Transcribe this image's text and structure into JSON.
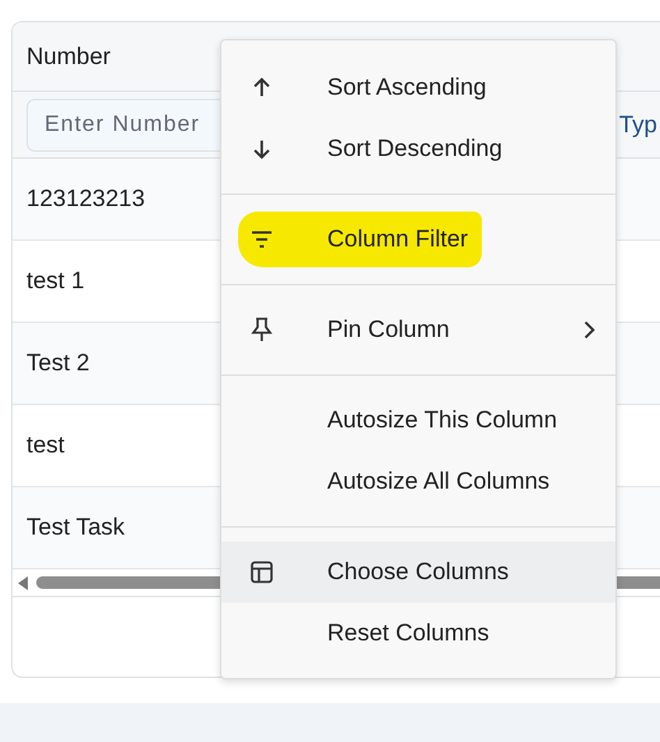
{
  "grid": {
    "column": "Number",
    "filter": {
      "placeholder": "Enter Number"
    },
    "next_filter_text": "Typ",
    "rows": [
      "123123213",
      "test 1",
      "Test 2",
      "test",
      "Test Task"
    ]
  },
  "menu": {
    "groups": [
      [
        {
          "label": "Sort Ascending",
          "kind": "up",
          "highlighted": false,
          "hovered": false,
          "submenu": false
        },
        {
          "label": "Sort Descending",
          "kind": "down",
          "highlighted": false,
          "hovered": false,
          "submenu": false
        }
      ],
      [
        {
          "label": "Column Filter",
          "kind": "filter",
          "highlighted": true,
          "hovered": false,
          "submenu": false
        }
      ],
      [
        {
          "label": "Pin Column",
          "kind": "pin",
          "highlighted": false,
          "hovered": false,
          "submenu": true
        }
      ],
      [
        {
          "label": "Autosize This Column",
          "kind": "none",
          "highlighted": false,
          "hovered": false,
          "submenu": false
        },
        {
          "label": "Autosize All Columns",
          "kind": "none",
          "highlighted": false,
          "hovered": false,
          "submenu": false
        }
      ],
      [
        {
          "label": "Choose Columns",
          "kind": "table",
          "highlighted": false,
          "hovered": true,
          "submenu": false
        },
        {
          "label": "Reset Columns",
          "kind": "none",
          "highlighted": false,
          "hovered": false,
          "submenu": false
        }
      ]
    ]
  }
}
